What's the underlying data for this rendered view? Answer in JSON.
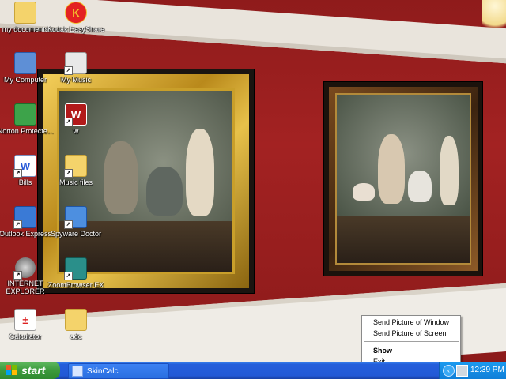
{
  "desktop": {
    "icons": [
      {
        "label": "my documents",
        "icon": "folder-documents-icon"
      },
      {
        "label": "Kodak EasyShare",
        "icon": "kodak-icon"
      },
      {
        "label": "My Computer",
        "icon": "computer-icon"
      },
      {
        "label": "My Music",
        "icon": "music-icon"
      },
      {
        "label": "Norton Protecte...",
        "icon": "recycle-bin-icon"
      },
      {
        "label": "w",
        "icon": "w-app-icon"
      },
      {
        "label": "Bills",
        "icon": "word-document-icon"
      },
      {
        "label": "Music files",
        "icon": "folder-icon"
      },
      {
        "label": "Outlook Express",
        "icon": "outlook-express-icon"
      },
      {
        "label": "Spyware Doctor",
        "icon": "spyware-doctor-icon"
      },
      {
        "label": "INTERNET EXPLORER",
        "icon": "internet-explorer-icon"
      },
      {
        "label": "ZoomBrowser EX",
        "icon": "zoombrowser-icon"
      },
      {
        "label": "Calculator",
        "icon": "calculator-icon"
      },
      {
        "label": "adc",
        "icon": "folder-icon"
      }
    ]
  },
  "context_menu": {
    "items": [
      "Send Picture of Window",
      "Send Picture of Screen",
      "Show",
      "Exit"
    ]
  },
  "taskbar": {
    "start_label": "start",
    "task_label": "SkinCalc",
    "expand_glyph": "‹",
    "clock": "12:39 PM"
  },
  "colors": {
    "wall": "#a32222",
    "taskbar": "#245edb",
    "start": "#3c9a3c",
    "tray": "#0f7fd8"
  }
}
